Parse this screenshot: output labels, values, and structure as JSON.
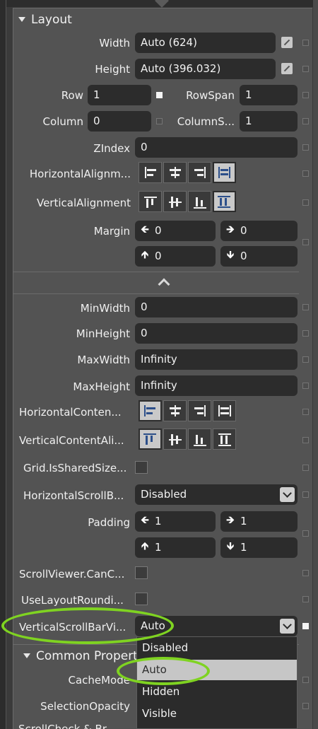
{
  "layout_section": {
    "title": "Layout",
    "width": {
      "label": "Width",
      "value": "Auto (624)"
    },
    "height": {
      "label": "Height",
      "value": "Auto (396.032)"
    },
    "row": {
      "label": "Row",
      "value": "1"
    },
    "rowspan": {
      "label": "RowSpan",
      "value": "1"
    },
    "column": {
      "label": "Column",
      "value": "0"
    },
    "columnspan": {
      "label": "ColumnS...",
      "value": "1"
    },
    "zindex": {
      "label": "ZIndex",
      "value": "0"
    },
    "horizontal_alignment": {
      "label": "HorizontalAlignm...",
      "options": [
        "left",
        "center",
        "right",
        "stretch"
      ],
      "selected": "stretch"
    },
    "vertical_alignment": {
      "label": "VerticalAlignment",
      "options": [
        "top",
        "center",
        "bottom",
        "stretch"
      ],
      "selected": "stretch"
    },
    "margin": {
      "label": "Margin",
      "left": "0",
      "right": "0",
      "top": "0",
      "bottom": "0"
    }
  },
  "advanced": {
    "minwidth": {
      "label": "MinWidth",
      "value": "0"
    },
    "minheight": {
      "label": "MinHeight",
      "value": "0"
    },
    "maxwidth": {
      "label": "MaxWidth",
      "value": "Infinity"
    },
    "maxheight": {
      "label": "MaxHeight",
      "value": "Infinity"
    },
    "horizontal_content": {
      "label": "HorizontalConten...",
      "options": [
        "left",
        "center",
        "right",
        "stretch"
      ],
      "selected": "left"
    },
    "vertical_content": {
      "label": "VerticalContentAli...",
      "options": [
        "top",
        "center",
        "bottom",
        "stretch"
      ],
      "selected": "top"
    },
    "grid_shared": {
      "label": "Grid.IsSharedSize..."
    },
    "horizontal_scrollbar": {
      "label": "HorizontalScrollB...",
      "value": "Disabled"
    },
    "padding": {
      "label": "Padding",
      "left": "1",
      "right": "1",
      "top": "1",
      "bottom": "1"
    },
    "scrollviewer_cancontent": {
      "label": "ScrollViewer.CanC..."
    },
    "use_layout_rounding": {
      "label": "UseLayoutRoundi..."
    },
    "vertical_scrollbar": {
      "label": "VerticalScrollBarVi...",
      "value": "Auto"
    }
  },
  "dropdown": {
    "options": [
      "Disabled",
      "Auto",
      "Hidden",
      "Visible"
    ],
    "highlighted": "Auto"
  },
  "common_section": {
    "title": "Common Propert",
    "cachemode": {
      "label": "CacheMode"
    },
    "selectionopacity": {
      "label": "SelectionOpacity"
    },
    "next_row": {
      "label": "ScrollCheck & Br..."
    }
  },
  "colors": {
    "panel": "#535353",
    "field": "#2c2c2c",
    "highlight_ring": "#7fd321",
    "dropdown_highlight": "#c6c6c6"
  }
}
